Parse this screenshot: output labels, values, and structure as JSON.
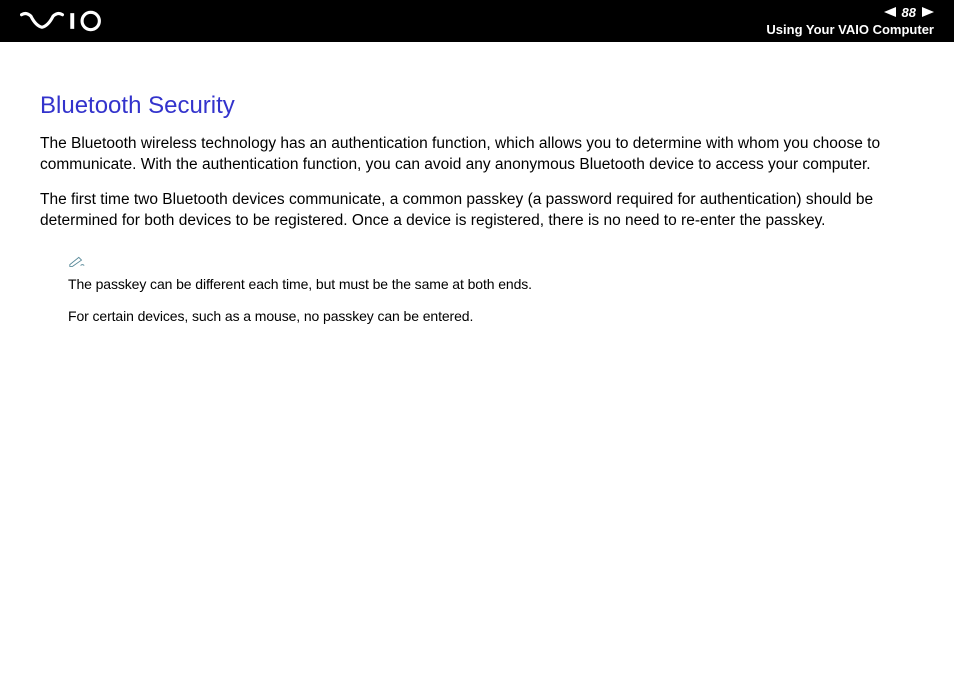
{
  "header": {
    "page_number": "88",
    "section_title": "Using Your VAIO Computer"
  },
  "main": {
    "title": "Bluetooth Security",
    "paragraph1": "The Bluetooth wireless technology has an authentication function, which allows you to determine with whom you choose to communicate. With the authentication function, you can avoid any anonymous Bluetooth device to access your computer.",
    "paragraph2": "The first time two Bluetooth devices communicate, a common passkey (a password required for authentication) should be determined for both devices to be registered. Once a device is registered, there is no need to re-enter the passkey.",
    "note1": "The passkey can be different each time, but must be the same at both ends.",
    "note2": "For certain devices, such as a mouse, no passkey can be entered."
  }
}
